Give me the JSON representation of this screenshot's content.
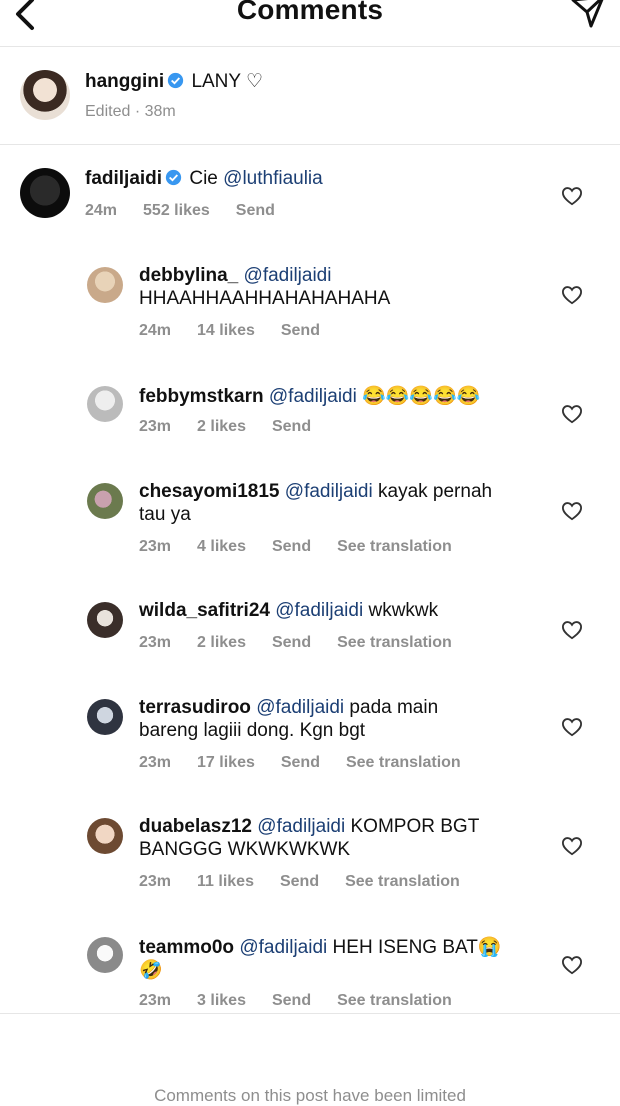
{
  "header": {
    "title": "Comments"
  },
  "caption": {
    "username": "hanggini",
    "text": "LANY ♡",
    "meta": "Edited · 38m"
  },
  "main_comment": {
    "username": "fadiljaidi",
    "prefix": "Cie ",
    "mention": "@luthfiaulia",
    "time": "24m",
    "likes": "552 likes",
    "send": "Send"
  },
  "replies": [
    {
      "username": "debbylina_",
      "mention": "@fadiljaidi",
      "line1": "",
      "line2": "HHAAHHAAHHAHAHAHAHA",
      "time": "24m",
      "likes": "14 likes",
      "send": "Send",
      "translate": ""
    },
    {
      "username": "febbymstkarn",
      "mention": "@fadiljaidi",
      "line1": " 😂😂😂😂😂",
      "line2": "",
      "time": "23m",
      "likes": "2 likes",
      "send": "Send",
      "translate": ""
    },
    {
      "username": "chesayomi1815",
      "mention": "@fadiljaidi",
      "line1": " kayak pernah",
      "line2": "tau ya",
      "time": "23m",
      "likes": "4 likes",
      "send": "Send",
      "translate": "See translation"
    },
    {
      "username": "wilda_safitri24",
      "mention": "@fadiljaidi",
      "line1": " wkwkwk",
      "line2": "",
      "time": "23m",
      "likes": "2 likes",
      "send": "Send",
      "translate": "See translation"
    },
    {
      "username": "terrasudiroo",
      "mention": "@fadiljaidi",
      "line1": " pada main",
      "line2": "bareng lagiii dong. Kgn bgt",
      "time": "23m",
      "likes": "17 likes",
      "send": "Send",
      "translate": "See translation"
    },
    {
      "username": "duabelasz12",
      "mention": "@fadiljaidi",
      "line1": " KOMPOR BGT",
      "line2": "BANGGG WKWKWKWK",
      "time": "23m",
      "likes": "11 likes",
      "send": "Send",
      "translate": "See translation"
    },
    {
      "username": "teammo0o",
      "mention": "@fadiljaidi",
      "line1": " HEH ISENG BAT😭",
      "line2": "🤣",
      "time": "23m",
      "likes": "3 likes",
      "send": "Send",
      "translate": "See translation"
    }
  ],
  "footer": {
    "limited": "Comments on this post have been limited"
  }
}
